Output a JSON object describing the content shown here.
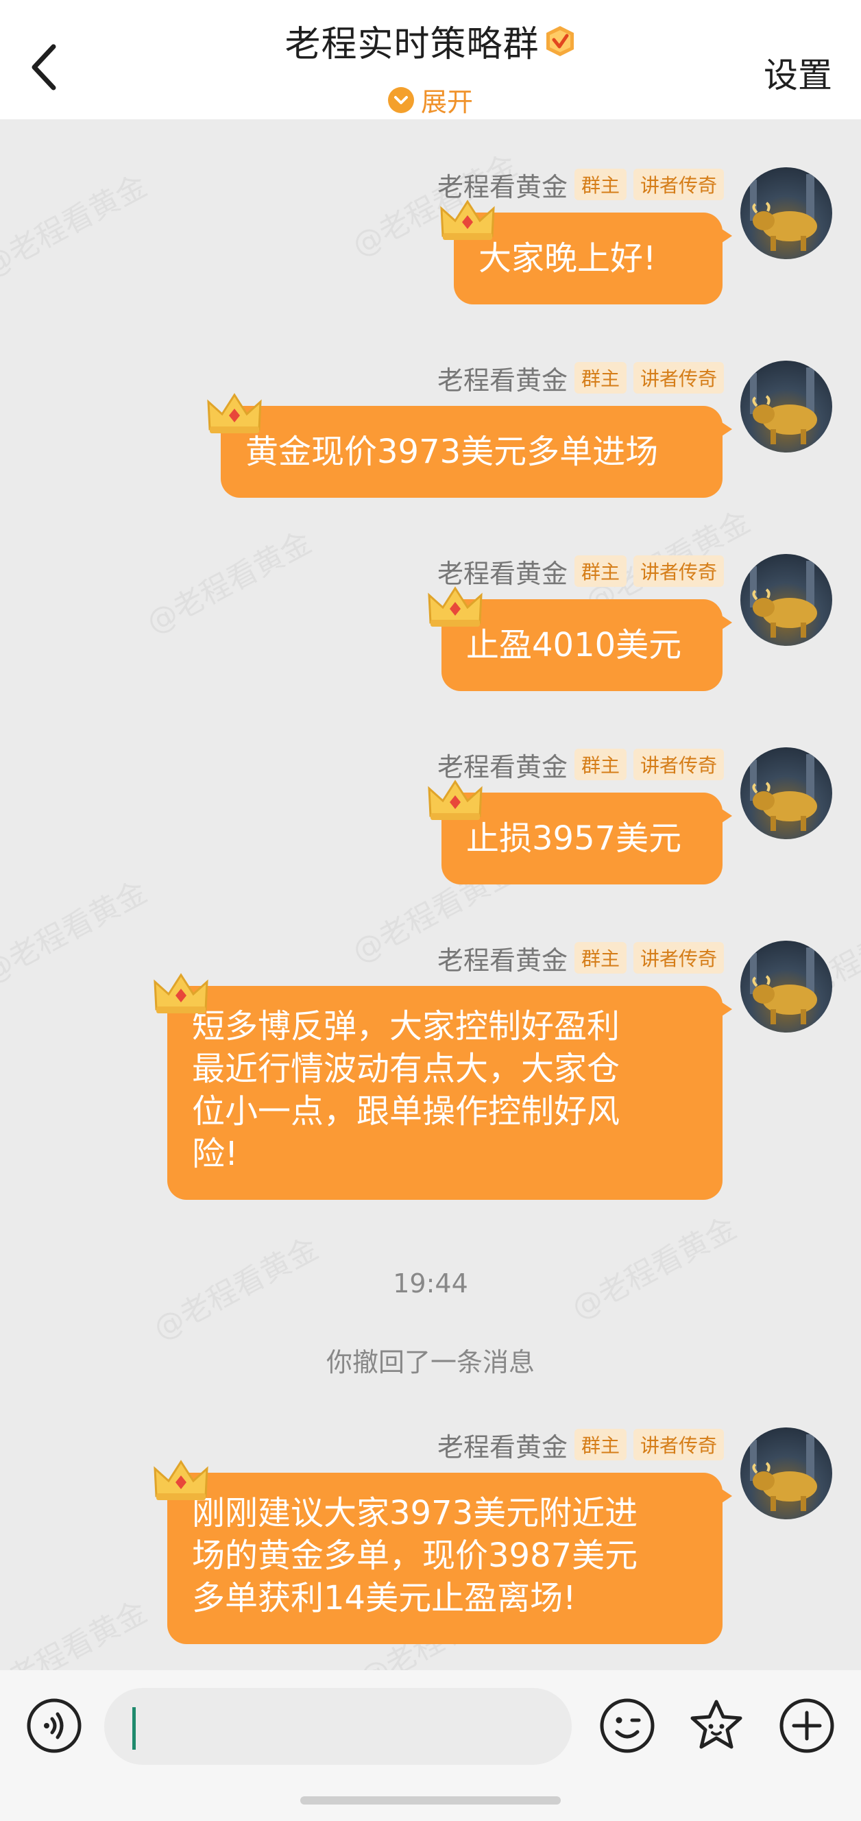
{
  "header": {
    "title": "老程实时策略群",
    "expand_label": "展开",
    "settings_label": "设置"
  },
  "watermark_text": "@老程看黄金",
  "messages": [
    {
      "sender": "老程看黄金",
      "badge_owner": "群主",
      "badge_title": "讲者传奇",
      "text": "大家晚上好!"
    },
    {
      "sender": "老程看黄金",
      "badge_owner": "群主",
      "badge_title": "讲者传奇",
      "text": "黄金现价3973美元多单进场"
    },
    {
      "sender": "老程看黄金",
      "badge_owner": "群主",
      "badge_title": "讲者传奇",
      "text": "止盈4010美元"
    },
    {
      "sender": "老程看黄金",
      "badge_owner": "群主",
      "badge_title": "讲者传奇",
      "text": "止损3957美元"
    },
    {
      "sender": "老程看黄金",
      "badge_owner": "群主",
      "badge_title": "讲者传奇",
      "lines": [
        "短多博反弹，大家控制好盈利",
        "最近行情波动有点大，大家仓",
        "位小一点，跟单操作控制好风",
        "险!"
      ]
    },
    {
      "sender": "老程看黄金",
      "badge_owner": "群主",
      "badge_title": "讲者传奇",
      "lines": [
        "刚刚建议大家3973美元附近进",
        "场的黄金多单，现价3987美元",
        "多单获利14美元止盈离场!"
      ]
    }
  ],
  "timestamp": "19:44",
  "recall_notice": "你撤回了一条消息",
  "input": {
    "value": "",
    "placeholder": ""
  },
  "colors": {
    "bubble": "#fb9a35",
    "accent": "#f0922a",
    "badge_bg": "#fbe8cc"
  },
  "icons": [
    "back-arrow-icon",
    "verified-icon",
    "expand-icon",
    "voice-icon",
    "emoji-icon",
    "sticker-icon",
    "plus-icon",
    "crown-icon",
    "avatar-bull-icon"
  ]
}
